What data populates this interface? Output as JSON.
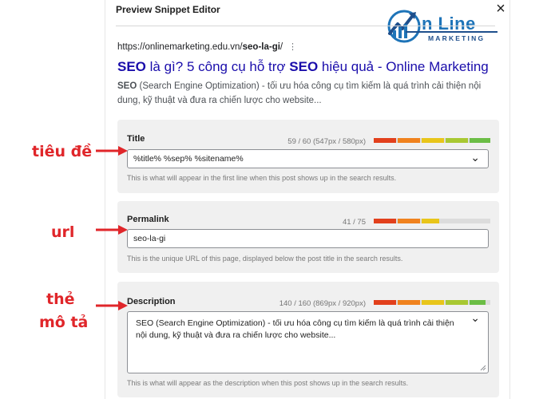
{
  "modal": {
    "title": "Preview Snippet Editor",
    "close_icon": "×"
  },
  "logo": {
    "text": "n Line",
    "sub": "MARKETING"
  },
  "snippet": {
    "url_prefix": "https://onlinemarketing.edu.vn/",
    "url_bold": "seo-la-gi",
    "url_suffix": "/",
    "dots": "⋮",
    "title_part1": "SEO",
    "title_part2": " là gì? 5 công cụ hỗ trợ ",
    "title_part3": "SEO",
    "title_part4": " hiệu quả - Online Marketing",
    "desc_bold": "SEO",
    "desc_rest": " (Search Engine Optimization) - tối ưu hóa công cụ tìm kiếm là quá trình cải thiện nội dung, kỹ thuật và đưa ra chiến lược cho website..."
  },
  "title_field": {
    "label": "Title",
    "counter": "59 / 60 (547px / 580px)",
    "value": "%title% %sep% %sitename%",
    "hint": "This is what will appear in the first line when this post shows up in the search results.",
    "chevron": "⌄"
  },
  "permalink_field": {
    "label": "Permalink",
    "counter": "41 / 75",
    "value": "seo-la-gi",
    "hint": "This is the unique URL of this page, displayed below the post title in the search results."
  },
  "description_field": {
    "label": "Description",
    "counter": "140 / 160 (869px / 920px)",
    "value": "SEO (Search Engine Optimization) - tối ưu hóa công cụ tìm kiếm là quá trình cải thiện nội dung, kỹ thuật và đưa ra chiến lược cho website...",
    "hint": "This is what will appear as the description when this post shows up in the search results.",
    "chevron": "⌄"
  },
  "annotations": {
    "title": "tiêu đề",
    "url": "url",
    "desc_line1": "thẻ",
    "desc_line2": "mô tả"
  },
  "colors": {
    "accent_red": "#e0262a",
    "link_blue": "#1a0dab",
    "meter_red": "#e2401c",
    "meter_orange": "#f0821e",
    "meter_yellow": "#e8c51a",
    "meter_green": "#6bbd45"
  }
}
